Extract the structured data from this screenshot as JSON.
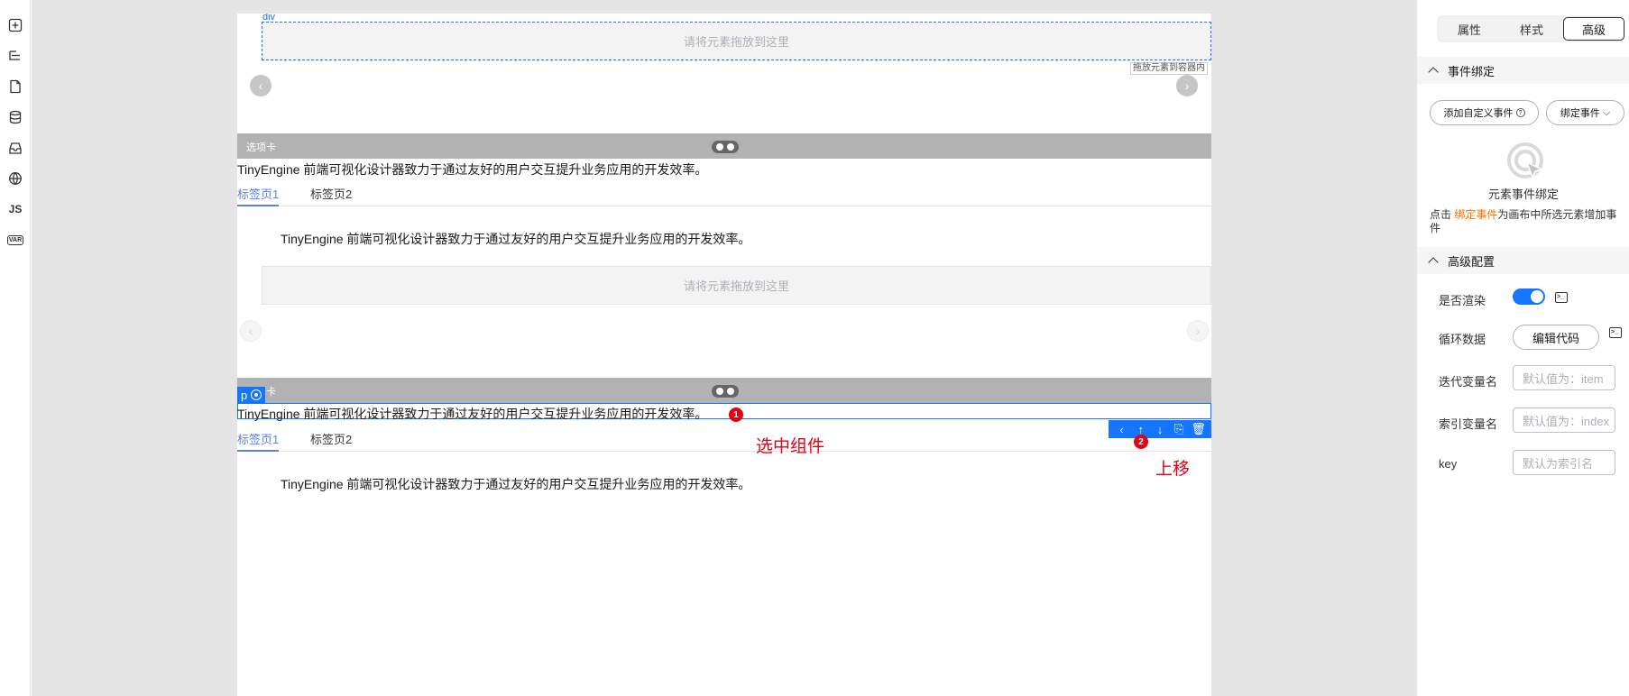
{
  "leftbar": {
    "items": [
      "add-icon",
      "outline-icon",
      "page-icon",
      "database-icon",
      "block-icon",
      "globe-icon",
      "js-icon",
      "var-icon"
    ],
    "js_label": "JS",
    "var_label": "VAR"
  },
  "canvas": {
    "div_label": "div",
    "drop_placeholder": "请将元素拖放到这里",
    "drop_hint": "拖放元素到容器内",
    "carousel_prev": "‹",
    "carousel_next": "›",
    "section1": {
      "title": "选项卡",
      "paragraph": "TinyEngine 前端可视化设计器致力于通过友好的用户交互提升业务应用的开发效率。",
      "tabs": [
        "标签页1",
        "标签页2"
      ],
      "tab_content": "TinyEngine 前端可视化设计器致力于通过友好的用户交互提升业务应用的开发效率。",
      "drop_placeholder": "请将元素拖放到这里"
    },
    "section2": {
      "title": "选项卡",
      "selected_tag": "p",
      "paragraph": "TinyEngine 前端可视化设计器致力于通过友好的用户交互提升业务应用的开发效率。",
      "tabs": [
        "标签页1",
        "标签页2"
      ],
      "tab_content": "TinyEngine 前端可视化设计器致力于通过友好的用户交互提升业务应用的开发效率。"
    },
    "toolbar": {
      "select_parent": "‹",
      "move_up": "↑",
      "move_down": "↓",
      "copy": "⎘",
      "delete": "🗑"
    },
    "annotations": {
      "badge1": "1",
      "badge2": "2",
      "note1": "选中组件",
      "note2": "上移"
    }
  },
  "panel": {
    "tabs": [
      "属性",
      "样式",
      "高级"
    ],
    "active_tab": "高级",
    "event_section": "事件绑定",
    "add_custom_event": "添加自定义事件",
    "bind_event": "绑定事件",
    "bind_title": "元素事件绑定",
    "bind_desc_prefix": "点击 ",
    "bind_desc_link": "绑定事件",
    "bind_desc_suffix": "为画布中所选元素增加事件",
    "advanced_section": "高级配置",
    "render_label": "是否渲染",
    "loop_label": "循环数据",
    "edit_code": "编辑代码",
    "iter_var_label": "迭代变量名",
    "iter_var_placeholder": "默认值为：item",
    "index_var_label": "索引变量名",
    "index_var_placeholder": "默认值为：index",
    "key_label": "key",
    "key_placeholder": "默认为索引名",
    "render_enabled": true
  },
  "colors": {
    "accent": "#1476ff",
    "annotation_red": "#e60012",
    "link_orange": "#f66f00",
    "tab_active": "#5e7ce0"
  }
}
